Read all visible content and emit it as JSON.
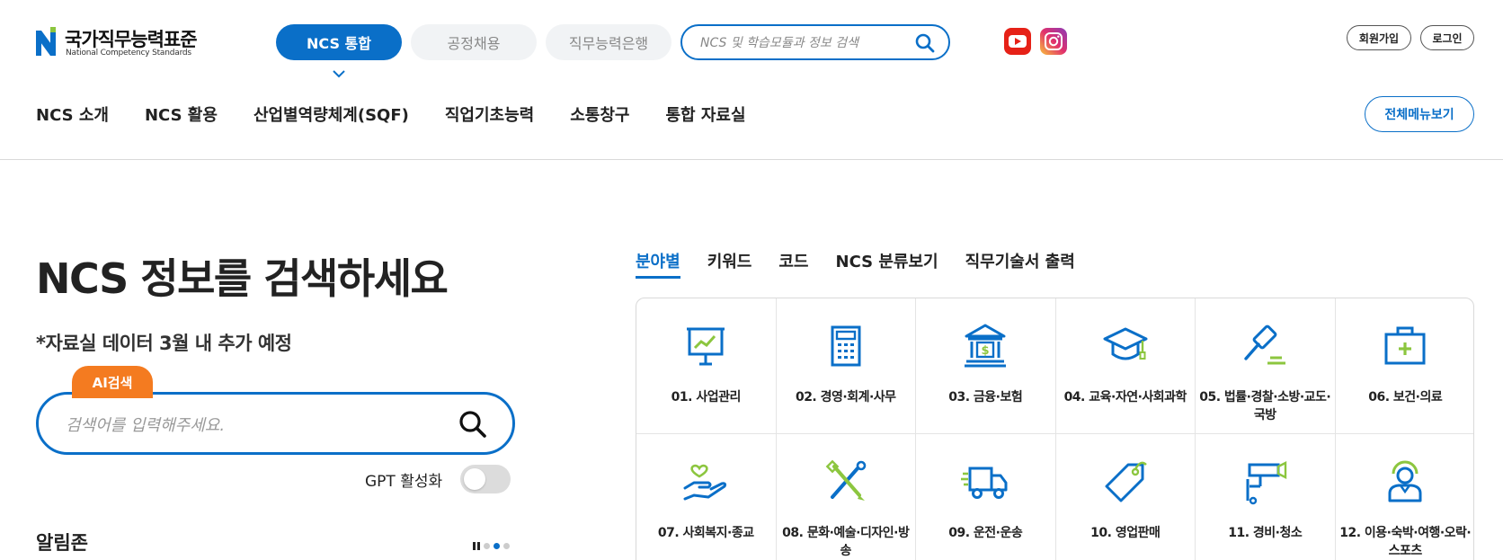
{
  "header": {
    "logo_ko": "국가직무능력표준",
    "logo_en": "National Competency Standards",
    "tabs": [
      {
        "label": "NCS 통합"
      },
      {
        "label": "공정채용"
      },
      {
        "label": "직무능력은행"
      }
    ],
    "search_placeholder": "NCS 및 학습모듈과 정보 검색",
    "join_label": "회원가입",
    "login_label": "로그인",
    "gnb": [
      {
        "label": "NCS 소개"
      },
      {
        "label": "NCS 활용"
      },
      {
        "label": "산업별역량체계(SQF)"
      },
      {
        "label": "직업기초능력"
      },
      {
        "label": "소통창구"
      },
      {
        "label": "통합 자료실"
      }
    ],
    "allmenu_label": "전체메뉴보기"
  },
  "search_section": {
    "title": "NCS 정보를 검색하세요",
    "note": "*자료실 데이터 3월 내 추가 예정",
    "ai_badge": "AI검색",
    "placeholder": "검색어를 입력해주세요.",
    "gpt_label": "GPT 활성화"
  },
  "notice": {
    "title": "알림존"
  },
  "category_tabs": [
    {
      "label": "분야별"
    },
    {
      "label": "키워드"
    },
    {
      "label": "코드"
    },
    {
      "label": "NCS 분류보기"
    },
    {
      "label": "직무기술서 출력"
    }
  ],
  "categories": [
    {
      "label": "01. 사업관리",
      "icon": "presentation-board-icon"
    },
    {
      "label": "02. 경영·회계·사무",
      "icon": "calculator-icon"
    },
    {
      "label": "03. 금융·보험",
      "icon": "bank-icon"
    },
    {
      "label": "04. 교육·자연·사회과학",
      "icon": "graduation-cap-icon"
    },
    {
      "label": "05. 법률·경찰·소방·교도·국방",
      "icon": "gavel-icon"
    },
    {
      "label": "06. 보건·의료",
      "icon": "first-aid-kit-icon"
    },
    {
      "label": "07. 사회복지·종교",
      "icon": "hand-heart-icon"
    },
    {
      "label": "08. 문화·예술·디자인·방송",
      "icon": "brush-pen-icon"
    },
    {
      "label": "09. 운전·운송",
      "icon": "truck-icon"
    },
    {
      "label": "10. 영업판매",
      "icon": "price-tag-icon"
    },
    {
      "label": "11. 경비·청소",
      "icon": "cctv-icon"
    },
    {
      "label": "12. 이용·숙박·여행·오락·스포츠",
      "icon": "person-icon"
    }
  ],
  "colors": {
    "primary": "#0a6fc8",
    "accent": "#f47b20",
    "icon_green": "#8cc63f"
  }
}
